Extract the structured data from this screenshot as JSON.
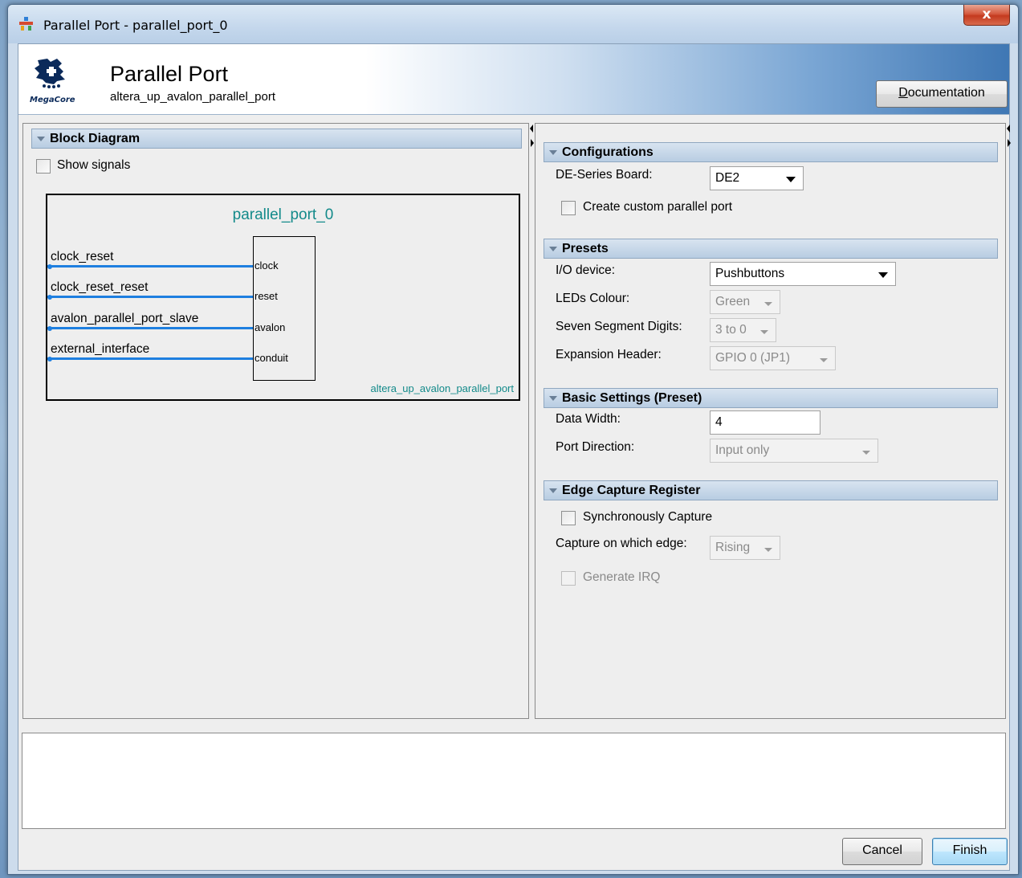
{
  "window": {
    "title": "Parallel Port - parallel_port_0",
    "close_label": "x"
  },
  "header": {
    "title": "Parallel Port",
    "subtitle": "altera_up_avalon_parallel_port",
    "logo_text": "MegaCore",
    "documentation_label_u": "D",
    "documentation_label_rest": "ocumentation"
  },
  "block_diagram": {
    "section_title": "Block Diagram",
    "show_signals_label": "Show signals",
    "component_name": "parallel_port_0",
    "component_type": "altera_up_avalon_parallel_port",
    "interfaces": [
      {
        "name": "clock_reset",
        "pin": "clock"
      },
      {
        "name": "clock_reset_reset",
        "pin": "reset"
      },
      {
        "name": "avalon_parallel_port_slave",
        "pin": "avalon"
      },
      {
        "name": "external_interface",
        "pin": "conduit"
      }
    ],
    "line_color": "#1e7fe0",
    "accent_text_color": "#138a8a"
  },
  "configurations": {
    "section_title": "Configurations",
    "board_label": "DE-Series Board:",
    "board_value": "DE2",
    "custom_label": "Create custom parallel port"
  },
  "presets": {
    "section_title": "Presets",
    "io_label": "I/O device:",
    "io_value": "Pushbuttons",
    "leds_label": "LEDs Colour:",
    "leds_value": "Green",
    "seg_label": "Seven Segment Digits:",
    "seg_value": "3 to 0",
    "exp_label": "Expansion Header:",
    "exp_value": "GPIO 0 (JP1)"
  },
  "basic": {
    "section_title": "Basic Settings (Preset)",
    "width_label": "Data Width:",
    "width_value": "4",
    "dir_label": "Port Direction:",
    "dir_value": "Input only"
  },
  "edge": {
    "section_title": "Edge Capture Register",
    "sync_label": "Synchronously Capture",
    "edge_label": "Capture on which edge:",
    "edge_value": "Rising",
    "irq_label": "Generate IRQ"
  },
  "footer": {
    "cancel_label": "Cancel",
    "finish_label": "Finish"
  }
}
